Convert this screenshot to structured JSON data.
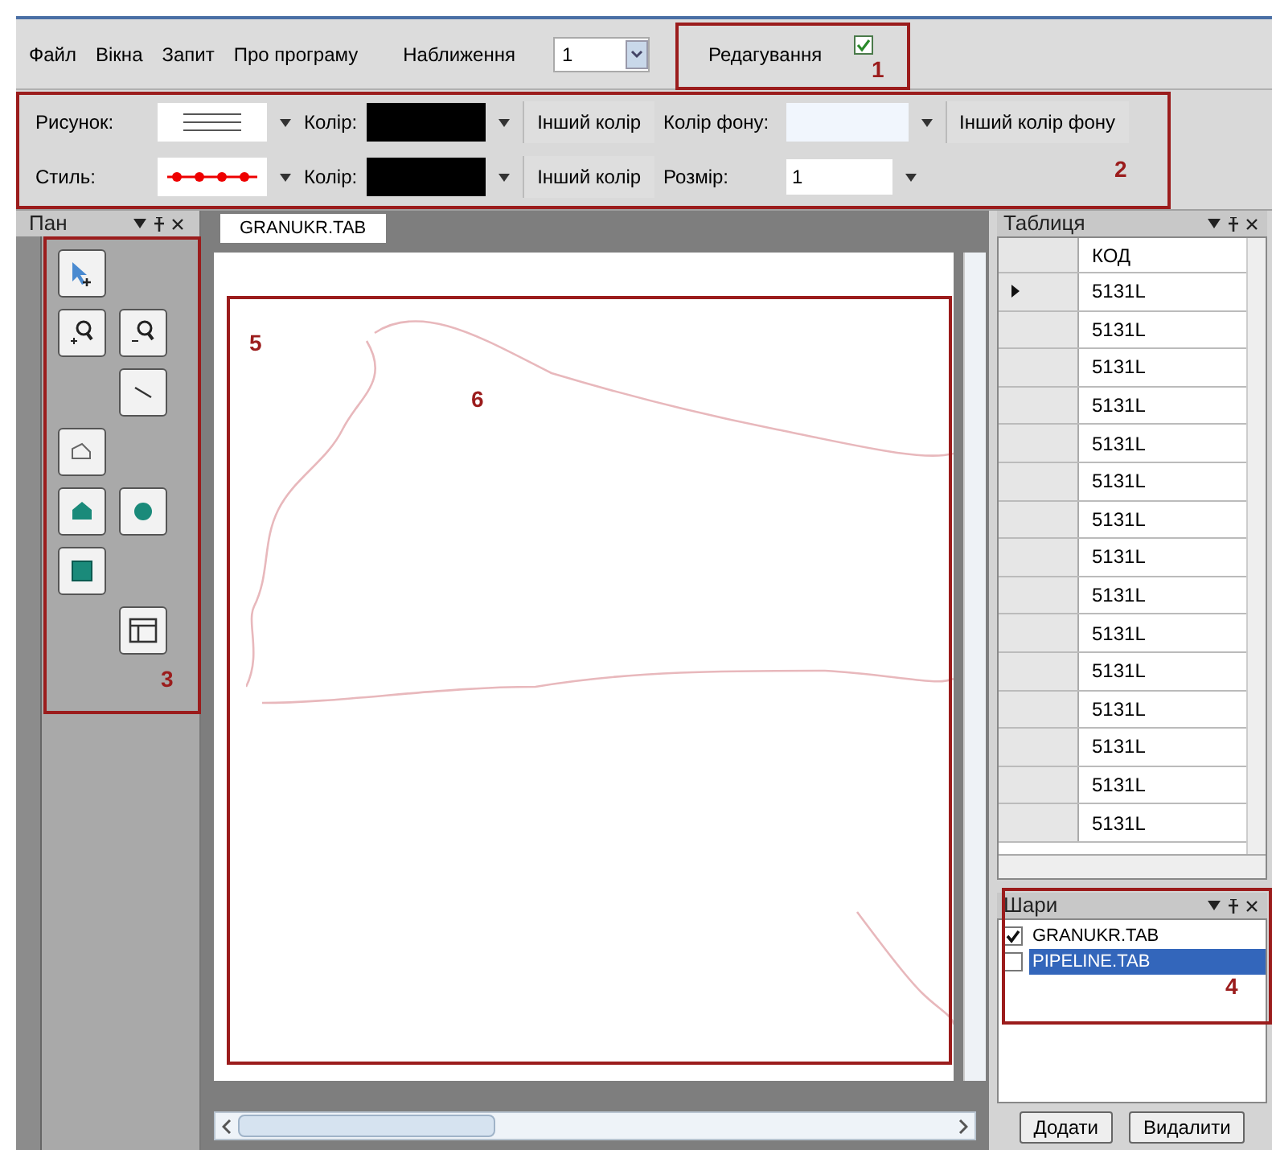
{
  "menu": [
    {
      "label": "Файл"
    },
    {
      "label": "Вікна"
    },
    {
      "label": "Запит"
    },
    {
      "label": "Про програму"
    }
  ],
  "zoom": {
    "label": "Наближення",
    "value": "1"
  },
  "editing": {
    "label": "Редагування",
    "checked": true
  },
  "style_toolbar": {
    "pattern_label": "Рисунок:",
    "color_label_1": "Колір:",
    "other_color_1": "Інший колір",
    "bg_color_label": "Колір фону:",
    "other_bg_color": "Інший колір фону",
    "style_label": "Стиль:",
    "color_label_2": "Колір:",
    "other_color_2": "Інший колір",
    "size_label": "Розмір:",
    "size_value": "1"
  },
  "tools_panel": {
    "title": "Пан",
    "tools": [
      {
        "kind": "select"
      },
      {
        "kind": "zoom_in"
      },
      {
        "kind": "zoom_out"
      },
      {
        "kind": "line"
      },
      {
        "kind": "polyline"
      },
      {
        "kind": "polygon"
      },
      {
        "kind": "ellipse"
      },
      {
        "kind": "rectangle"
      },
      {
        "kind": "table"
      }
    ]
  },
  "map": {
    "tab": "GRANUKR.TAB"
  },
  "table": {
    "title": "Таблиця",
    "columns": [
      "КОД"
    ],
    "rows": [
      {
        "cells": [
          "5131L"
        ],
        "selected": true
      },
      {
        "cells": [
          "5131L"
        ],
        "selected": false
      },
      {
        "cells": [
          "5131L"
        ],
        "selected": false
      },
      {
        "cells": [
          "5131L"
        ],
        "selected": false
      },
      {
        "cells": [
          "5131L"
        ],
        "selected": false
      },
      {
        "cells": [
          "5131L"
        ],
        "selected": false
      },
      {
        "cells": [
          "5131L"
        ],
        "selected": false
      },
      {
        "cells": [
          "5131L"
        ],
        "selected": false
      },
      {
        "cells": [
          "5131L"
        ],
        "selected": false
      },
      {
        "cells": [
          "5131L"
        ],
        "selected": false
      },
      {
        "cells": [
          "5131L"
        ],
        "selected": false
      },
      {
        "cells": [
          "5131L"
        ],
        "selected": false
      },
      {
        "cells": [
          "5131L"
        ],
        "selected": false
      },
      {
        "cells": [
          "5131L"
        ],
        "selected": false
      },
      {
        "cells": [
          "5131L"
        ],
        "selected": false
      }
    ]
  },
  "layers": {
    "title": "Шари",
    "items": [
      {
        "name": "GRANUKR.TAB",
        "checked": true,
        "selected": false
      },
      {
        "name": "PIPELINE.TAB",
        "checked": false,
        "selected": true
      }
    ]
  },
  "buttons": [
    {
      "label": "Додати"
    },
    {
      "label": "Видалити"
    }
  ],
  "annotations": [
    {
      "label": "1",
      "boxed": true
    },
    {
      "label": "2",
      "boxed": true
    },
    {
      "label": "3",
      "boxed": true
    },
    {
      "label": "4",
      "boxed": true
    },
    {
      "label": "5",
      "boxed": true
    },
    {
      "label": "6",
      "boxed": false
    }
  ]
}
